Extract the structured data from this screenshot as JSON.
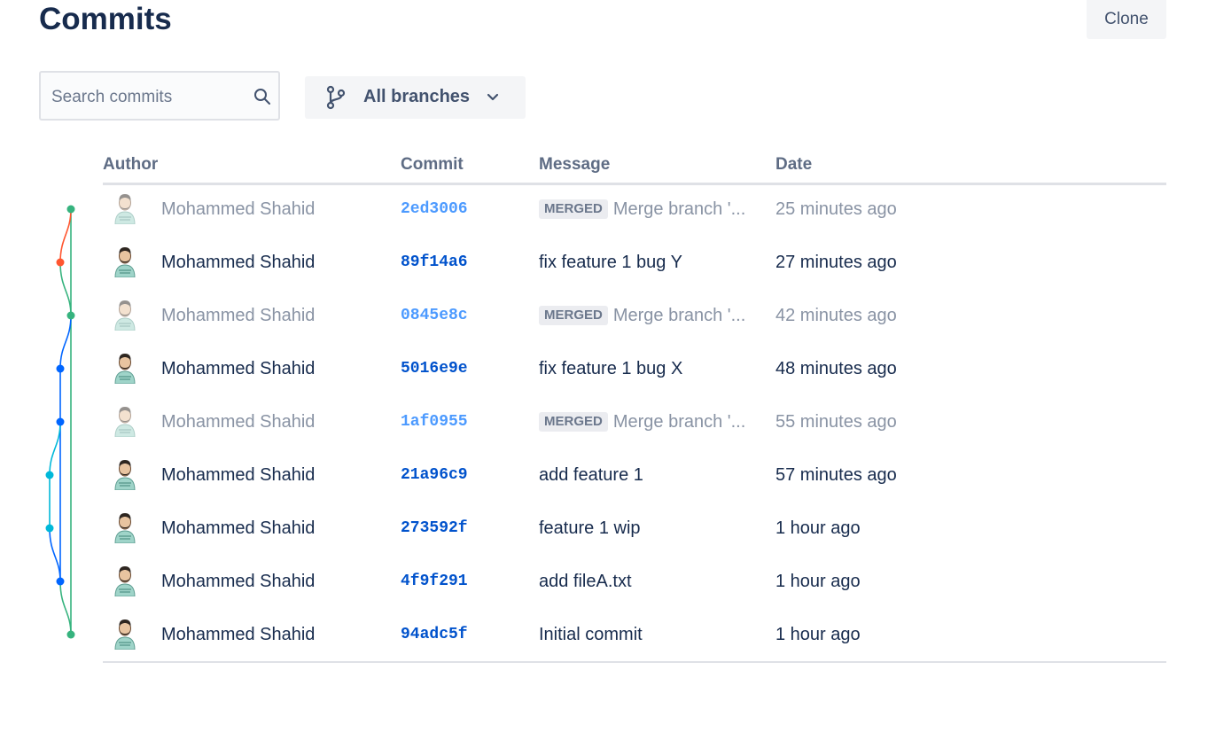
{
  "header": {
    "title": "Commits",
    "clone_label": "Clone"
  },
  "search": {
    "placeholder": "Search commits",
    "value": ""
  },
  "branch_filter": {
    "label": "All branches"
  },
  "table": {
    "columns": [
      "Author",
      "Commit",
      "Message",
      "Date"
    ],
    "rows": [
      {
        "author": "Mohammed Shahid",
        "hash": "2ed3006",
        "merged": true,
        "lozenge": "MERGED",
        "message": "Merge branch '...",
        "date": "25 minutes ago"
      },
      {
        "author": "Mohammed Shahid",
        "hash": "89f14a6",
        "merged": false,
        "lozenge": "",
        "message": "fix feature 1 bug Y",
        "date": "27 minutes ago"
      },
      {
        "author": "Mohammed Shahid",
        "hash": "0845e8c",
        "merged": true,
        "lozenge": "MERGED",
        "message": "Merge branch '...",
        "date": "42 minutes ago"
      },
      {
        "author": "Mohammed Shahid",
        "hash": "5016e9e",
        "merged": false,
        "lozenge": "",
        "message": "fix feature 1 bug X",
        "date": "48 minutes ago"
      },
      {
        "author": "Mohammed Shahid",
        "hash": "1af0955",
        "merged": true,
        "lozenge": "MERGED",
        "message": "Merge branch '...",
        "date": "55 minutes ago"
      },
      {
        "author": "Mohammed Shahid",
        "hash": "21a96c9",
        "merged": false,
        "lozenge": "",
        "message": "add feature 1",
        "date": "57 minutes ago"
      },
      {
        "author": "Mohammed Shahid",
        "hash": "273592f",
        "merged": false,
        "lozenge": "",
        "message": "feature 1 wip",
        "date": "1 hour ago"
      },
      {
        "author": "Mohammed Shahid",
        "hash": "4f9f291",
        "merged": false,
        "lozenge": "",
        "message": "add fileA.txt",
        "date": "1 hour ago"
      },
      {
        "author": "Mohammed Shahid",
        "hash": "94adc5f",
        "merged": false,
        "lozenge": "",
        "message": "Initial commit",
        "date": "1 hour ago"
      }
    ]
  },
  "graph_colors": {
    "green": "#36b37e",
    "red": "#ff5630",
    "blue": "#0065ff",
    "cyan": "#00b8d9"
  },
  "icons": {
    "search": "search-icon",
    "branch": "branch-icon",
    "chevron": "chevron-down-icon",
    "avatar": "avatar"
  }
}
